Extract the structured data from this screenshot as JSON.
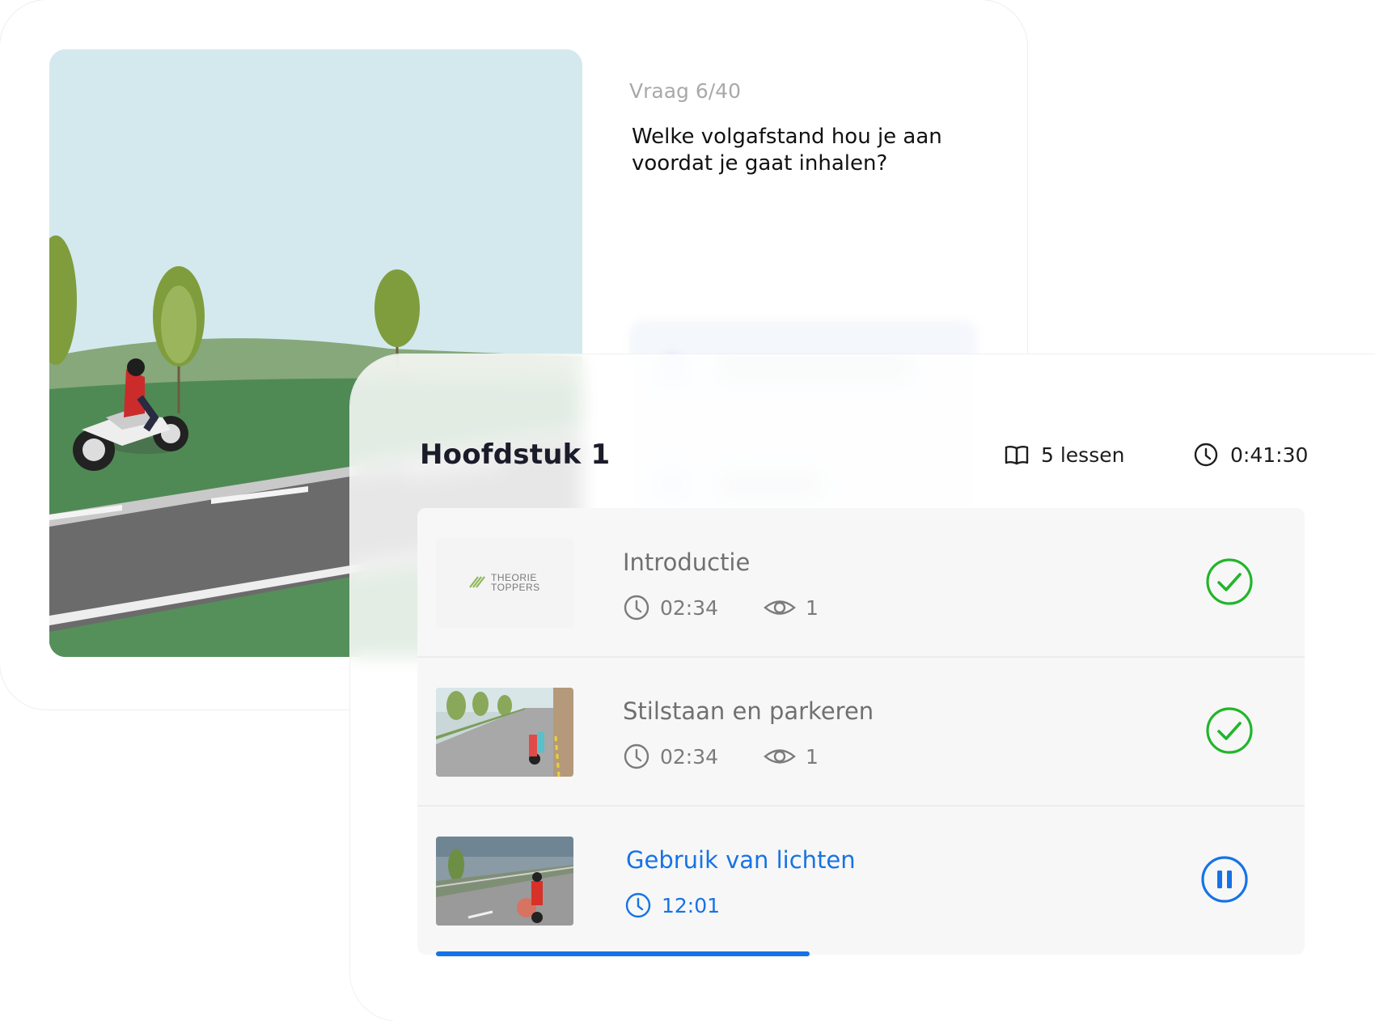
{
  "quiz": {
    "counter": "Vraag 6/40",
    "question": "Welke volgafstand hou je aan voordat je gaat inhalen?"
  },
  "chapter": {
    "title": "Hoofdstuk 1",
    "lessons_count": "5 lessen",
    "total_duration": "0:41:30",
    "progress_fraction": 0.44,
    "lessons": [
      {
        "title": "Introductie",
        "duration": "02:34",
        "views": "1",
        "status": "completed",
        "thumb_logo": [
          "THEORIE",
          "TOPPERS"
        ]
      },
      {
        "title": "Stilstaan en parkeren",
        "duration": "02:34",
        "views": "1",
        "status": "completed"
      },
      {
        "title": "Gebruik van lichten",
        "duration": "12:01",
        "status": "playing"
      }
    ]
  },
  "colors": {
    "accent": "#1673e6",
    "success": "#22b52a"
  },
  "icons": {
    "lessons": "book-icon",
    "duration": "clock-icon",
    "views": "eye-icon",
    "completed": "check-circle-icon",
    "playing": "pause-circle-icon"
  }
}
